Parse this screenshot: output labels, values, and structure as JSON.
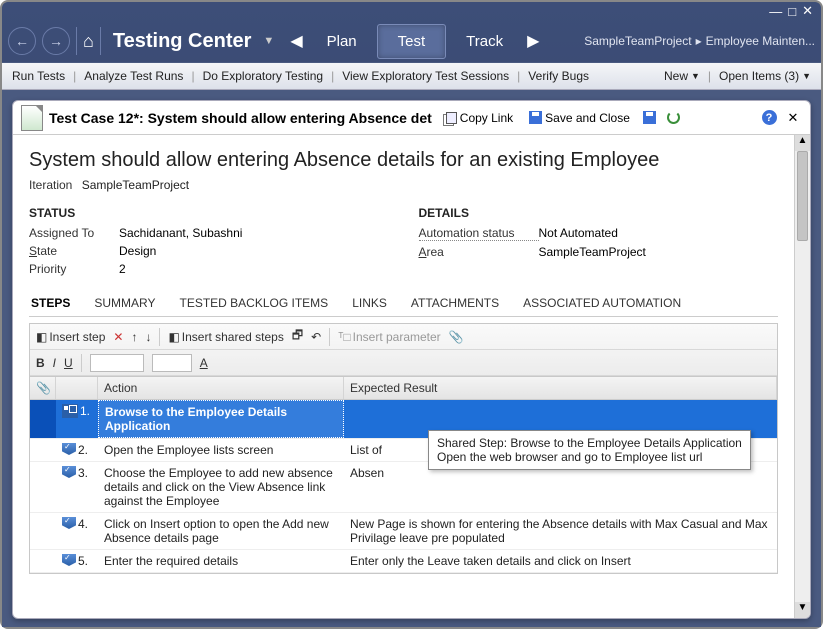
{
  "window_controls": {
    "min": "—",
    "max": "□",
    "close": "✕"
  },
  "topnav": {
    "app_name": "Testing Center",
    "tabs": {
      "plan": "Plan",
      "test": "Test",
      "track": "Track"
    },
    "breadcrumb": {
      "project": "SampleTeamProject",
      "item": "Employee Mainten..."
    }
  },
  "toolbar": {
    "run_tests": "Run Tests",
    "analyze": "Analyze Test Runs",
    "exploratory": "Do Exploratory Testing",
    "view_sessions": "View Exploratory Test Sessions",
    "verify_bugs": "Verify Bugs",
    "new": "New",
    "open_items": "Open Items (3)"
  },
  "panel": {
    "title": "Test Case 12*: System should allow entering Absence det",
    "copy_link": "Copy Link",
    "save_close": "Save and Close"
  },
  "testcase": {
    "heading": "System should allow entering Absence details for an existing Employee",
    "iteration_label": "Iteration",
    "iteration_value": "SampleTeamProject",
    "status_hdr": "STATUS",
    "details_hdr": "DETAILS",
    "assigned_label": "Assigned To",
    "assigned_value": "Sachidanant, Subashni",
    "state_label": "State",
    "state_value": "Design",
    "priority_label": "Priority",
    "priority_value": "2",
    "automation_label": "Automation status",
    "automation_value": "Not Automated",
    "area_label": "Area",
    "area_value": "SampleTeamProject"
  },
  "tabs": {
    "steps": "STEPS",
    "summary": "SUMMARY",
    "backlog": "TESTED BACKLOG ITEMS",
    "links": "LINKS",
    "attachments": "ATTACHMENTS",
    "automation": "ASSOCIATED AUTOMATION"
  },
  "steps_toolbar": {
    "insert_step": "Insert step",
    "insert_shared": "Insert shared steps",
    "insert_param": "Insert parameter"
  },
  "grid": {
    "hdr_action": "Action",
    "hdr_expected": "Expected Result",
    "rows": [
      {
        "num": "1.",
        "action": "Browse to the Employee Details Application",
        "expected": ""
      },
      {
        "num": "2.",
        "action": "Open the Employee lists screen",
        "expected": "List of"
      },
      {
        "num": "3.",
        "action": "Choose the Employee to add new absence details and click on the View Absence link against the Employee",
        "expected": "Absen"
      },
      {
        "num": "4.",
        "action": "Click on Insert option to open the Add new Absence details page",
        "expected": "New Page is shown for entering the Absence details with Max Casual and Max Privilage leave pre populated"
      },
      {
        "num": "5.",
        "action": "Enter the required details",
        "expected": "Enter only the Leave taken details and click on Insert"
      }
    ]
  },
  "tooltip": {
    "line1": "Shared Step: Browse to the Employee Details Application",
    "line2": "Open the web browser and go to Employee list url"
  }
}
